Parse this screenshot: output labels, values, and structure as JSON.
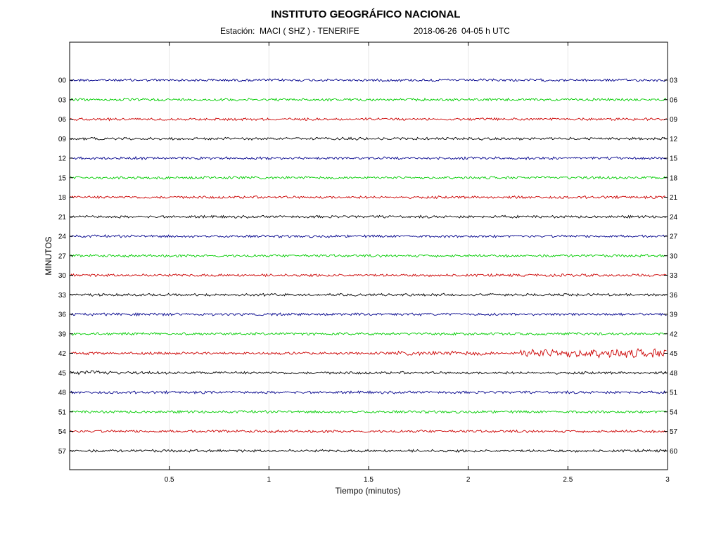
{
  "header": {
    "title": "INSTITUTO GEOGRÁFICO NACIONAL",
    "station": "Estación:  MACI ( SHZ ) - TENERIFE",
    "datetime": "2018-06-26  04-05 h UTC"
  },
  "chart_data": {
    "type": "line",
    "xlabel": "Tiempo (minutos)",
    "ylabel": "MINUTOS",
    "xlim": [
      0,
      3
    ],
    "x_ticks": [
      "0.5",
      "1",
      "1.5",
      "2",
      "2.5",
      "3"
    ],
    "x_tick_values": [
      0.5,
      1,
      1.5,
      2,
      2.5,
      3
    ],
    "grid": "vertical",
    "colors": [
      "#00008b",
      "#00cc00",
      "#cc0000",
      "#000000"
    ],
    "traces": [
      {
        "left": "00",
        "right": "03",
        "color": "#00008b"
      },
      {
        "left": "03",
        "right": "06",
        "color": "#00cc00"
      },
      {
        "left": "06",
        "right": "09",
        "color": "#cc0000"
      },
      {
        "left": "09",
        "right": "12",
        "color": "#000000"
      },
      {
        "left": "12",
        "right": "15",
        "color": "#00008b"
      },
      {
        "left": "15",
        "right": "18",
        "color": "#00cc00"
      },
      {
        "left": "18",
        "right": "21",
        "color": "#cc0000"
      },
      {
        "left": "21",
        "right": "24",
        "color": "#000000"
      },
      {
        "left": "24",
        "right": "27",
        "color": "#00008b"
      },
      {
        "left": "27",
        "right": "30",
        "color": "#00cc00"
      },
      {
        "left": "30",
        "right": "33",
        "color": "#cc0000"
      },
      {
        "left": "33",
        "right": "36",
        "color": "#000000"
      },
      {
        "left": "36",
        "right": "39",
        "color": "#00008b"
      },
      {
        "left": "39",
        "right": "42",
        "color": "#00cc00"
      },
      {
        "left": "42",
        "right": "45",
        "color": "#cc0000"
      },
      {
        "left": "45",
        "right": "48",
        "color": "#000000"
      },
      {
        "left": "48",
        "right": "51",
        "color": "#00008b"
      },
      {
        "left": "51",
        "right": "54",
        "color": "#00cc00"
      },
      {
        "left": "54",
        "right": "57",
        "color": "#cc0000"
      },
      {
        "left": "57",
        "right": "60",
        "color": "#000000"
      }
    ]
  }
}
